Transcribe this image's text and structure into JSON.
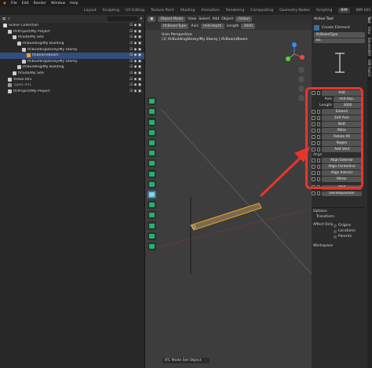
{
  "top_menu": [
    "File",
    "Edit",
    "Render",
    "Window",
    "Help"
  ],
  "workspaces": [
    {
      "label": "Layout",
      "active": false
    },
    {
      "label": "Sculpting",
      "active": false
    },
    {
      "label": "UV Editing",
      "active": false
    },
    {
      "label": "Texture Paint",
      "active": false
    },
    {
      "label": "Shading",
      "active": false
    },
    {
      "label": "Animation",
      "active": false
    },
    {
      "label": "Rendering",
      "active": false
    },
    {
      "label": "Compositing",
      "active": false
    },
    {
      "label": "Geometry Nodes",
      "active": false
    },
    {
      "label": "Scripting",
      "active": false
    },
    {
      "label": "BIM",
      "active": true
    },
    {
      "label": "BIM 001",
      "active": false
    }
  ],
  "outliner": {
    "header": "Scene Collection",
    "rows": [
      {
        "label": "Scene Collection",
        "indent": 0,
        "selected": false,
        "dim": false,
        "icon": "#ddd"
      },
      {
        "label": "IfcProject/My Project",
        "indent": 1,
        "selected": false,
        "dim": false,
        "icon": "#ccc"
      },
      {
        "label": "IfcSite/My Site",
        "indent": 2,
        "selected": false,
        "dim": false,
        "icon": "#ccc"
      },
      {
        "label": "IfcBuilding/My Building",
        "indent": 3,
        "selected": false,
        "dim": false,
        "icon": "#ccc"
      },
      {
        "label": "IfcBuildingStorey/My Storey",
        "indent": 4,
        "selected": false,
        "dim": false,
        "icon": "#ccc"
      },
      {
        "label": "IfcBeam/Beam",
        "indent": 5,
        "selected": true,
        "dim": false,
        "icon": "#f0a030"
      },
      {
        "label": "IfcBuildingStorey/My Storey",
        "indent": 4,
        "selected": false,
        "dim": false,
        "icon": "#ccc"
      },
      {
        "label": "IfcBuilding/My Building",
        "indent": 3,
        "selected": false,
        "dim": false,
        "icon": "#ccc"
      },
      {
        "label": "IfcSite/My Site",
        "indent": 2,
        "selected": false,
        "dim": false,
        "icon": "#ccc"
      },
      {
        "label": "Views.001",
        "indent": 1,
        "selected": false,
        "dim": false,
        "icon": "#ccc"
      },
      {
        "label": "Types.001",
        "indent": 1,
        "selected": false,
        "dim": true,
        "icon": "#999"
      },
      {
        "label": "IfcProject/My Project",
        "indent": 1,
        "selected": false,
        "dim": false,
        "icon": "#ccc"
      }
    ]
  },
  "viewport": {
    "mode": "Object Mode",
    "menu": [
      "View",
      "Select",
      "Add",
      "Object"
    ],
    "orientation": "Global",
    "header2": {
      "type": "IfcBeamType",
      "axis": "Axis",
      "axis_value": "mid-depth",
      "length_label": "Length",
      "length_value": "3000"
    },
    "info_line1": "User Perspective",
    "info_line2": "(1) IfcBuildingStorey/My Storey | IfcBeam/Beam",
    "status": "IFC Mode Set Object"
  },
  "panel": {
    "section": "Active Tool",
    "tool_name": "Create Element",
    "type": "IfcBeamType",
    "type_value": "B1",
    "add": "Add",
    "axis_label": "Axis",
    "axis_value": "mid-dep...",
    "length_label": "Length",
    "length_value": "3000",
    "buttons": [
      "Extend",
      "Edit Axis",
      "Butt",
      "Mitre",
      "Rotate 90",
      "Regen",
      "Add Void"
    ],
    "align_label": "Align",
    "align_buttons": [
      "Align Exterior",
      "Align Centerline",
      "Align Interior",
      "Mirror"
    ],
    "lower_buttons": [
      "Void",
      "Decomposition"
    ],
    "options": "Options",
    "transform": "Transform",
    "affect_only": "Affect Only",
    "checks": [
      "Origins",
      "Locations",
      "Parents"
    ],
    "workspace": "Workspace"
  },
  "tabs": [
    "Tool",
    "View",
    "BlenderBIM",
    "BIM Toolkit"
  ]
}
